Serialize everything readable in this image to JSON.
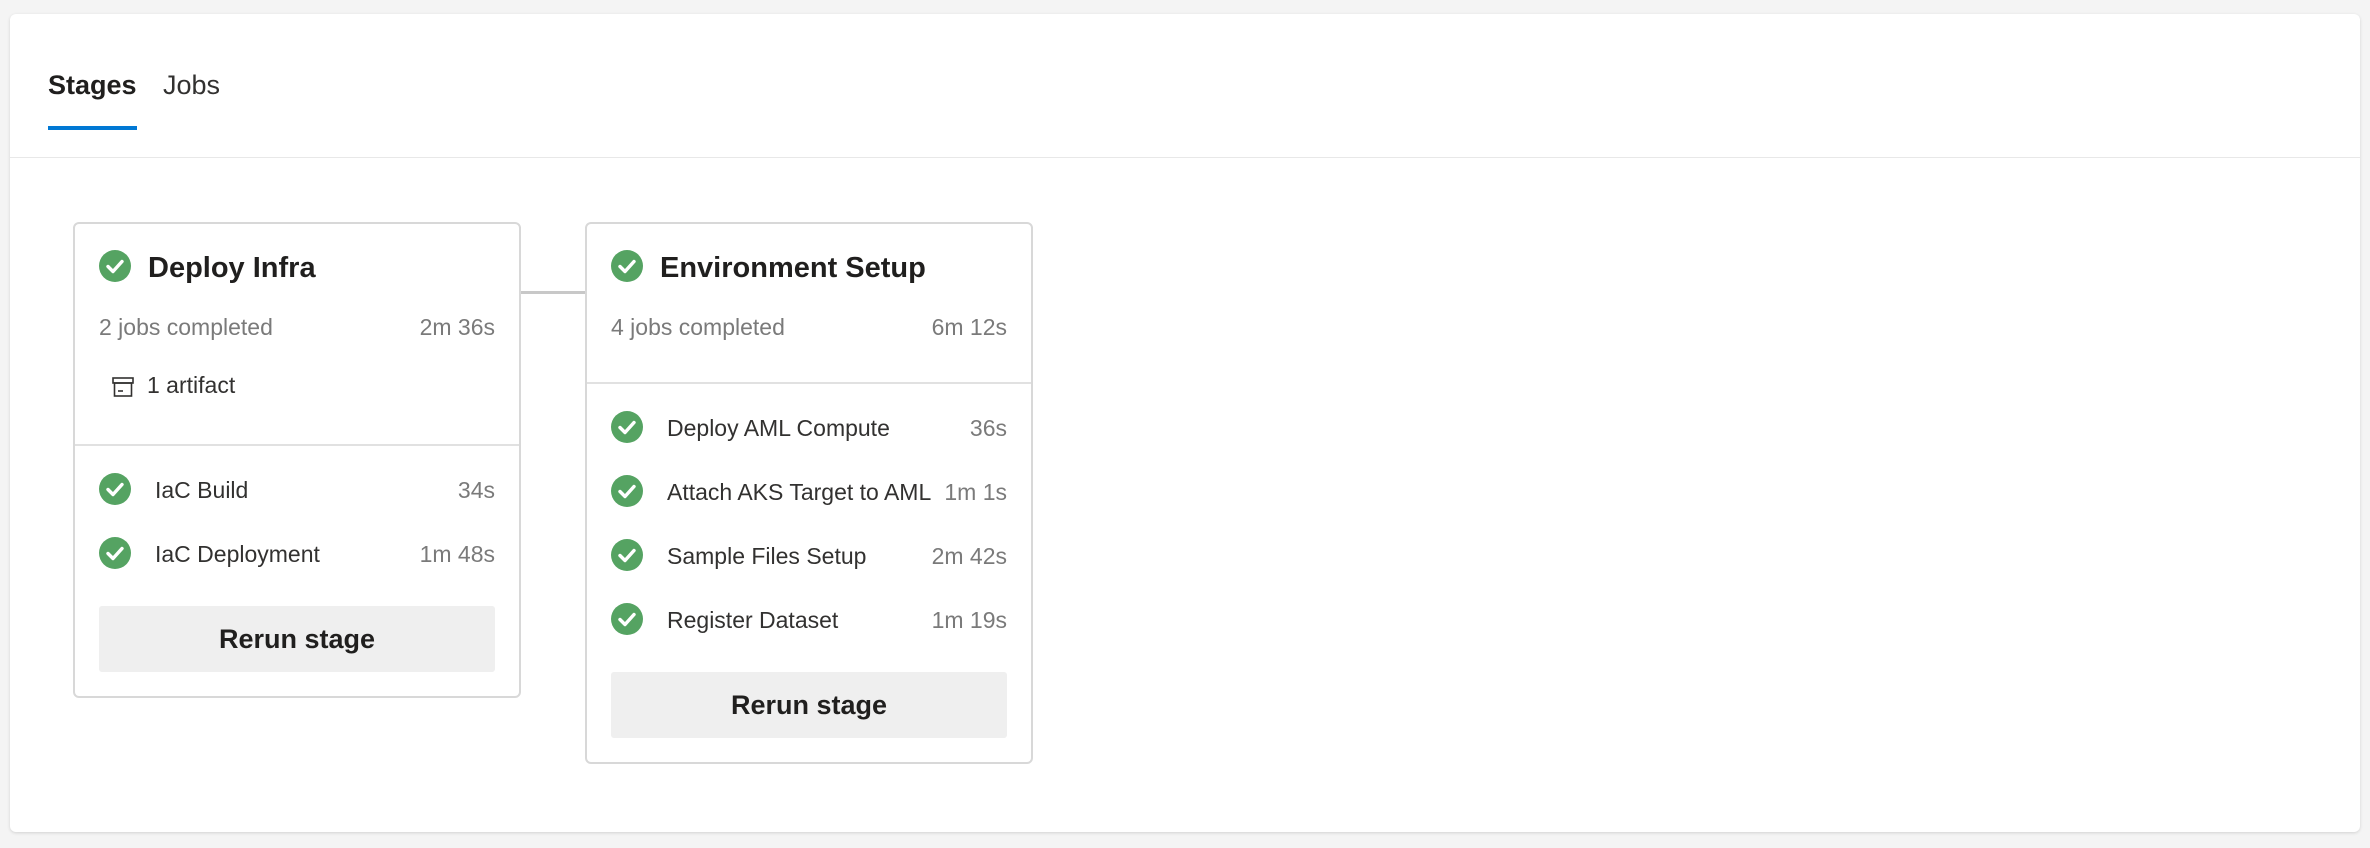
{
  "tabs": {
    "stages": "Stages",
    "jobs": "Jobs"
  },
  "colors": {
    "accent": "#0078d4",
    "success": "#55a362"
  },
  "stages": [
    {
      "title": "Deploy Infra",
      "summary": "2 jobs completed",
      "duration": "2m 36s",
      "artifact": "1 artifact",
      "jobs": [
        {
          "name": "IaC Build",
          "duration": "34s"
        },
        {
          "name": "IaC Deployment",
          "duration": "1m 48s"
        }
      ],
      "rerun": "Rerun stage"
    },
    {
      "title": "Environment Setup",
      "summary": "4 jobs completed",
      "duration": "6m 12s",
      "jobs": [
        {
          "name": "Deploy AML Compute",
          "duration": "36s"
        },
        {
          "name": "Attach AKS Target to AML",
          "duration": "1m 1s"
        },
        {
          "name": "Sample Files Setup",
          "duration": "2m 42s"
        },
        {
          "name": "Register Dataset",
          "duration": "1m 19s"
        }
      ],
      "rerun": "Rerun stage"
    }
  ]
}
